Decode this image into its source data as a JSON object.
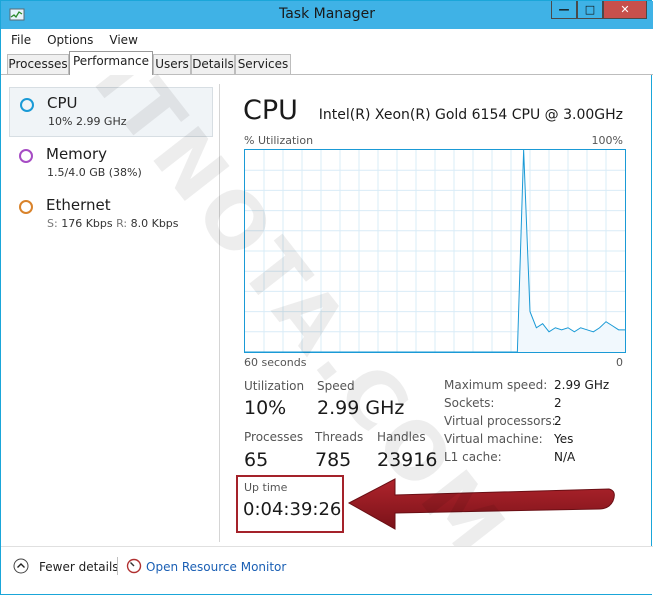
{
  "window": {
    "title": "Task Manager",
    "minimize_glyph": "—",
    "maximize_glyph": "□",
    "close_glyph": "✕"
  },
  "menu": [
    "File",
    "Options",
    "View"
  ],
  "tabs": [
    "Processes",
    "Performance",
    "Users",
    "Details",
    "Services"
  ],
  "active_tab": "Performance",
  "sidebar": {
    "items": [
      {
        "name": "CPU",
        "sub": "10%  2.99 GHz",
        "ring_color": "#1a9ad6"
      },
      {
        "name": "Memory",
        "sub": "1.5/4.0 GB (38%)",
        "ring_color": "#a64cc4"
      },
      {
        "name": "Ethernet",
        "sub_s_label": "S:",
        "sub_s_value": "176 Kbps",
        "sub_r_label": "R:",
        "sub_r_value": "8.0 Kbps",
        "ring_color": "#d9832b"
      }
    ]
  },
  "main": {
    "title": "CPU",
    "model": "Intel(R) Xeon(R) Gold 6154 CPU @ 3.00GHz",
    "graph": {
      "y_label": "% Utilization",
      "y_max_label": "100%",
      "x_left_label": "60 seconds",
      "x_right_label": "0",
      "color": "#1a9ad6",
      "points": [
        0,
        0,
        0,
        0,
        0,
        0,
        0,
        0,
        0,
        0,
        0,
        0,
        0,
        0,
        0,
        0,
        0,
        0,
        0,
        0,
        0,
        0,
        0,
        0,
        0,
        0,
        0,
        0,
        0,
        0,
        0,
        0,
        0,
        0,
        0,
        0,
        0,
        0,
        0,
        0,
        0,
        0,
        0,
        0,
        100,
        20,
        12,
        14,
        10,
        12,
        11,
        12,
        10,
        12,
        11,
        10,
        12,
        15,
        13,
        11,
        11
      ]
    },
    "stats": {
      "utilization_label": "Utilization",
      "utilization_value": "10%",
      "speed_label": "Speed",
      "speed_value": "2.99 GHz",
      "processes_label": "Processes",
      "processes_value": "65",
      "threads_label": "Threads",
      "threads_value": "785",
      "handles_label": "Handles",
      "handles_value": "23916",
      "uptime_label": "Up time",
      "uptime_value": "0:04:39:26"
    },
    "details": [
      {
        "label": "Maximum speed:",
        "value": "2.99 GHz"
      },
      {
        "label": "Sockets:",
        "value": "2"
      },
      {
        "label": "Virtual processors:",
        "value": "2"
      },
      {
        "label": "Virtual machine:",
        "value": "Yes"
      },
      {
        "label": "L1 cache:",
        "value": "N/A"
      }
    ]
  },
  "footer": {
    "fewer_details": "Fewer details",
    "open_resource_monitor": "Open Resource Monitor"
  },
  "annotation": {
    "watermark": "ITNOTA.COM",
    "highlight_color": "#a4222a"
  }
}
